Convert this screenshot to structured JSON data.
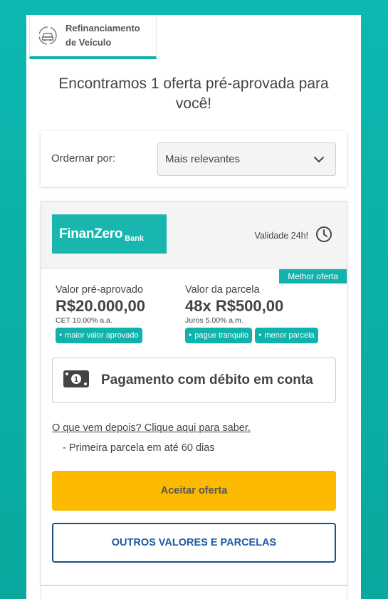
{
  "tab": {
    "label_line1": "Refinanciamento",
    "label_line2": "de Veículo",
    "icon": "car-refinance-icon"
  },
  "headline": "Encontramos 1 oferta pré-aprovada para você!",
  "sort": {
    "label": "Ordernar por:",
    "selected": "Mais relevantes"
  },
  "offer": {
    "logo_name": "FinanZero",
    "logo_sub": "Bank",
    "validity": "Validade 24h!",
    "best_badge": "Melhor oferta",
    "preapproved": {
      "title": "Valor pré-aprovado",
      "value": "R$20.000,00",
      "sub": "CET 10.00% a.a.",
      "chips": [
        "maior valor aprovado"
      ]
    },
    "installment": {
      "title": "Valor da parcela",
      "value": "48x R$500,00",
      "sub": "Juros 5.00% a.m.",
      "chips": [
        "pague tranquilo",
        "menor parcela"
      ]
    },
    "payment_method": "Pagamento com débito em conta",
    "after_link": "O que vem depois? Clique aqui para saber.",
    "after_item": "- Primeira parcela em até 60 dias",
    "accept_button": "Aceitar oferta",
    "others_button": "OUTROS VALORES E PARCELAS"
  },
  "colors": {
    "background": "#0cb8b0",
    "accent": "#11b2ab",
    "accept": "#fbb900",
    "outline_blue": "#1b4f88"
  }
}
